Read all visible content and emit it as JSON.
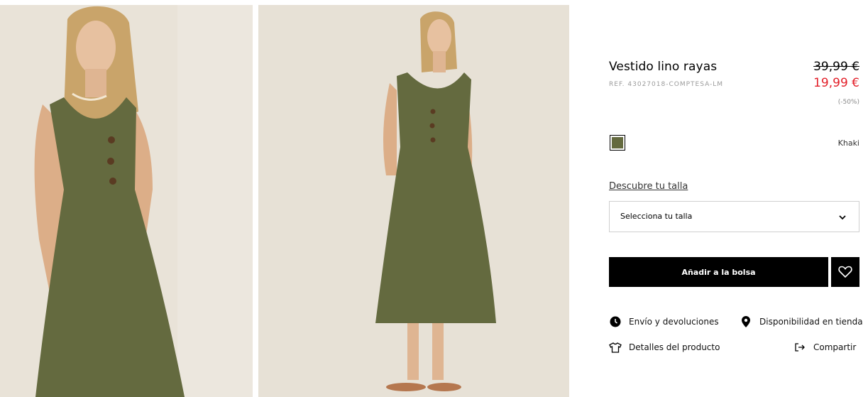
{
  "gallery": {
    "images": [
      {
        "alt": "Vestido lino rayas - vista 1"
      },
      {
        "alt": "Vestido lino rayas - vista 2"
      }
    ]
  },
  "product": {
    "name": "Vestido lino rayas",
    "ref": "REF. 43027018-COMPTESA-LM",
    "price_original": "39,99 €",
    "price_sale": "19,99 €",
    "discount": "(-50%)",
    "color_name": "Khaki",
    "color_hex": "#646a3f",
    "sale_color": "#e3202a"
  },
  "size": {
    "guide_link": "Descubre tu talla",
    "select_label": "Selecciona tu talla"
  },
  "actions": {
    "add_to_bag": "Añadir a la bolsa"
  },
  "links": {
    "shipping": "Envío y devoluciones",
    "store": "Disponibilidad en tienda",
    "details": "Detalles del producto",
    "share": "Compartir"
  },
  "icons": {
    "shipping": "clock-icon",
    "store": "location-pin-icon",
    "details": "shirt-icon",
    "share": "share-arrow-icon",
    "favorite": "heart-icon",
    "select": "chevron-down-icon"
  }
}
